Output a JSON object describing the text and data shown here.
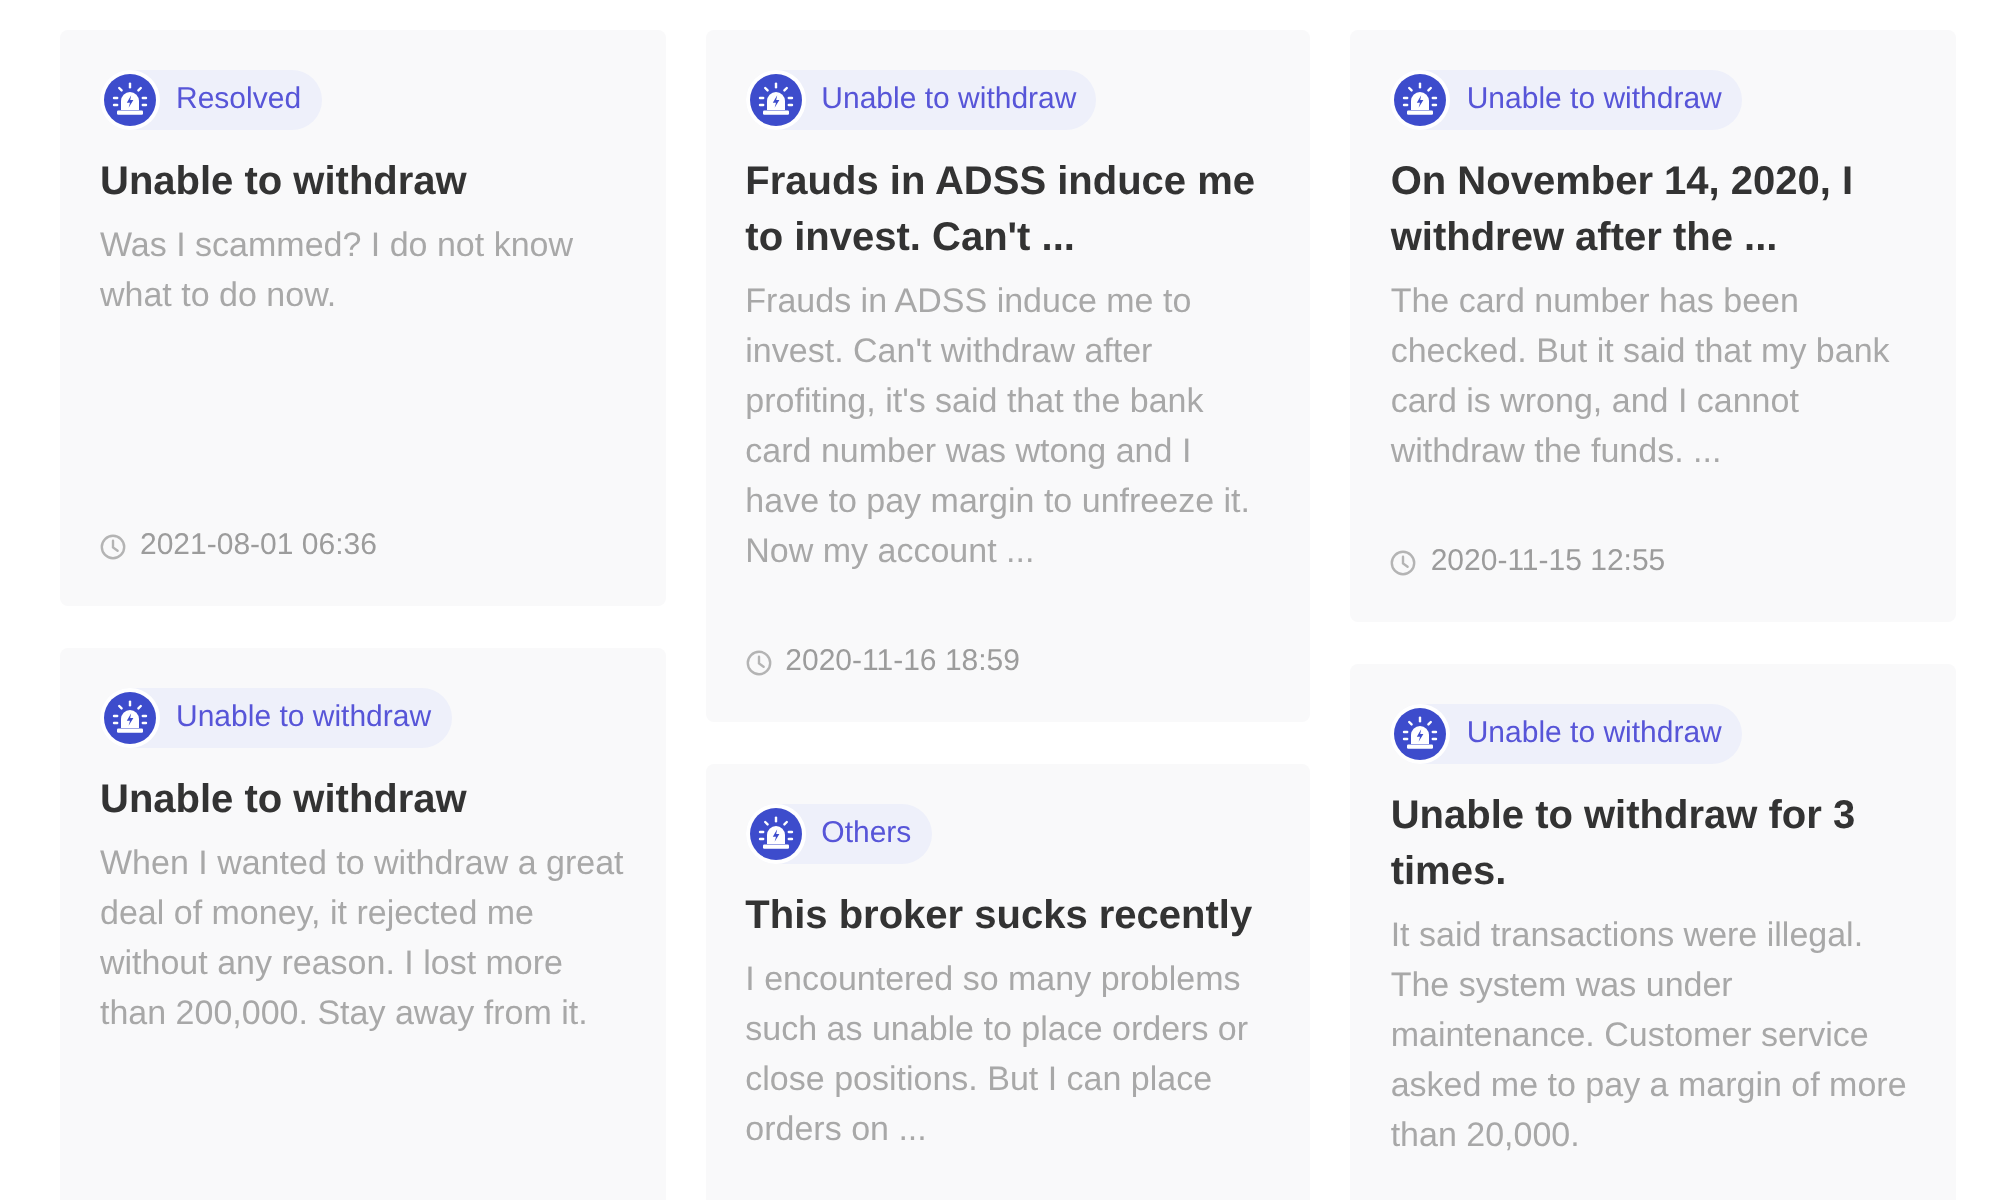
{
  "columns": [
    {
      "cards": [
        {
          "category": "Resolved",
          "title": "Unable to withdraw",
          "body": "Was I scammed? I do not know what to do now.",
          "date": "2021-08-01 06:36"
        },
        {
          "category": "Unable to withdraw",
          "title": "Unable to withdraw",
          "body": "When I wanted to withdraw a great deal of money, it rejected me without any reason. I lost more than 200,000. Stay away from it."
        }
      ]
    },
    {
      "cards": [
        {
          "category": "Unable to withdraw",
          "title": "Frauds in ADSS induce me to invest. Can't ...",
          "body": "Frauds in ADSS induce me to invest. Can't withdraw after profiting, it's said that the bank card number was wtong and I have to pay margin to unfreeze it. Now my account ...",
          "date": "2020-11-16 18:59"
        },
        {
          "category": "Others",
          "title": "This broker sucks recently",
          "body": "I encountered so many problems such as unable to place orders or close positions. But I can place orders on ..."
        }
      ]
    },
    {
      "cards": [
        {
          "category": "Unable to withdraw",
          "title": "On November 14, 2020, I withdrew after the ...",
          "body": "The card number has been checked. But it said that my bank card is wrong, and I cannot withdraw the funds. ...",
          "date": "2020-11-15 12:55"
        },
        {
          "category": "Unable to withdraw",
          "title": "Unable to withdraw for 3 times.",
          "body": "It said transactions were illegal. The system was under maintenance. Customer service asked me to pay a margin of more than 20,000."
        }
      ]
    }
  ]
}
